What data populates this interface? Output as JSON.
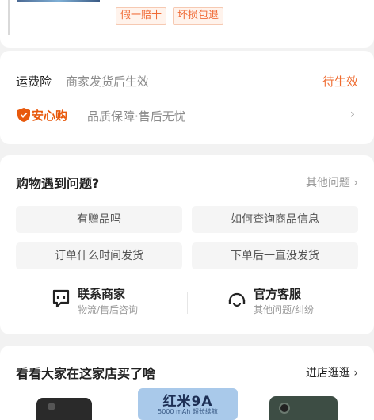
{
  "product_tags": [
    "假一赔十",
    "坏损包退"
  ],
  "insurance": {
    "label": "运费险",
    "desc": "商家发货后生效",
    "status": "待生效"
  },
  "anxin": {
    "badge": "安心购",
    "desc": "品质保障·售后无忧",
    "chevron": "›"
  },
  "problems": {
    "title": "购物遇到问题?",
    "more": "其他问题 ›",
    "chips": [
      "有赠品吗",
      "如何查询商品信息",
      "订单什么时间发货",
      "下单后一直没发货"
    ]
  },
  "contact": {
    "merchant_title": "联系商家",
    "merchant_sub": "物流/售后咨询",
    "service_title": "官方客服",
    "service_sub": "其他问题/纠纷"
  },
  "shop": {
    "title": "看看大家在这家店买了啥",
    "more": "进店逛逛 ›",
    "banner_text": "红米9A",
    "banner_sub": "5000 mAh 超长续航"
  },
  "colors": {
    "accent": "#ef6b2f",
    "tag_bg": "#fff3ec",
    "page_bg": "#f2f2f2"
  }
}
